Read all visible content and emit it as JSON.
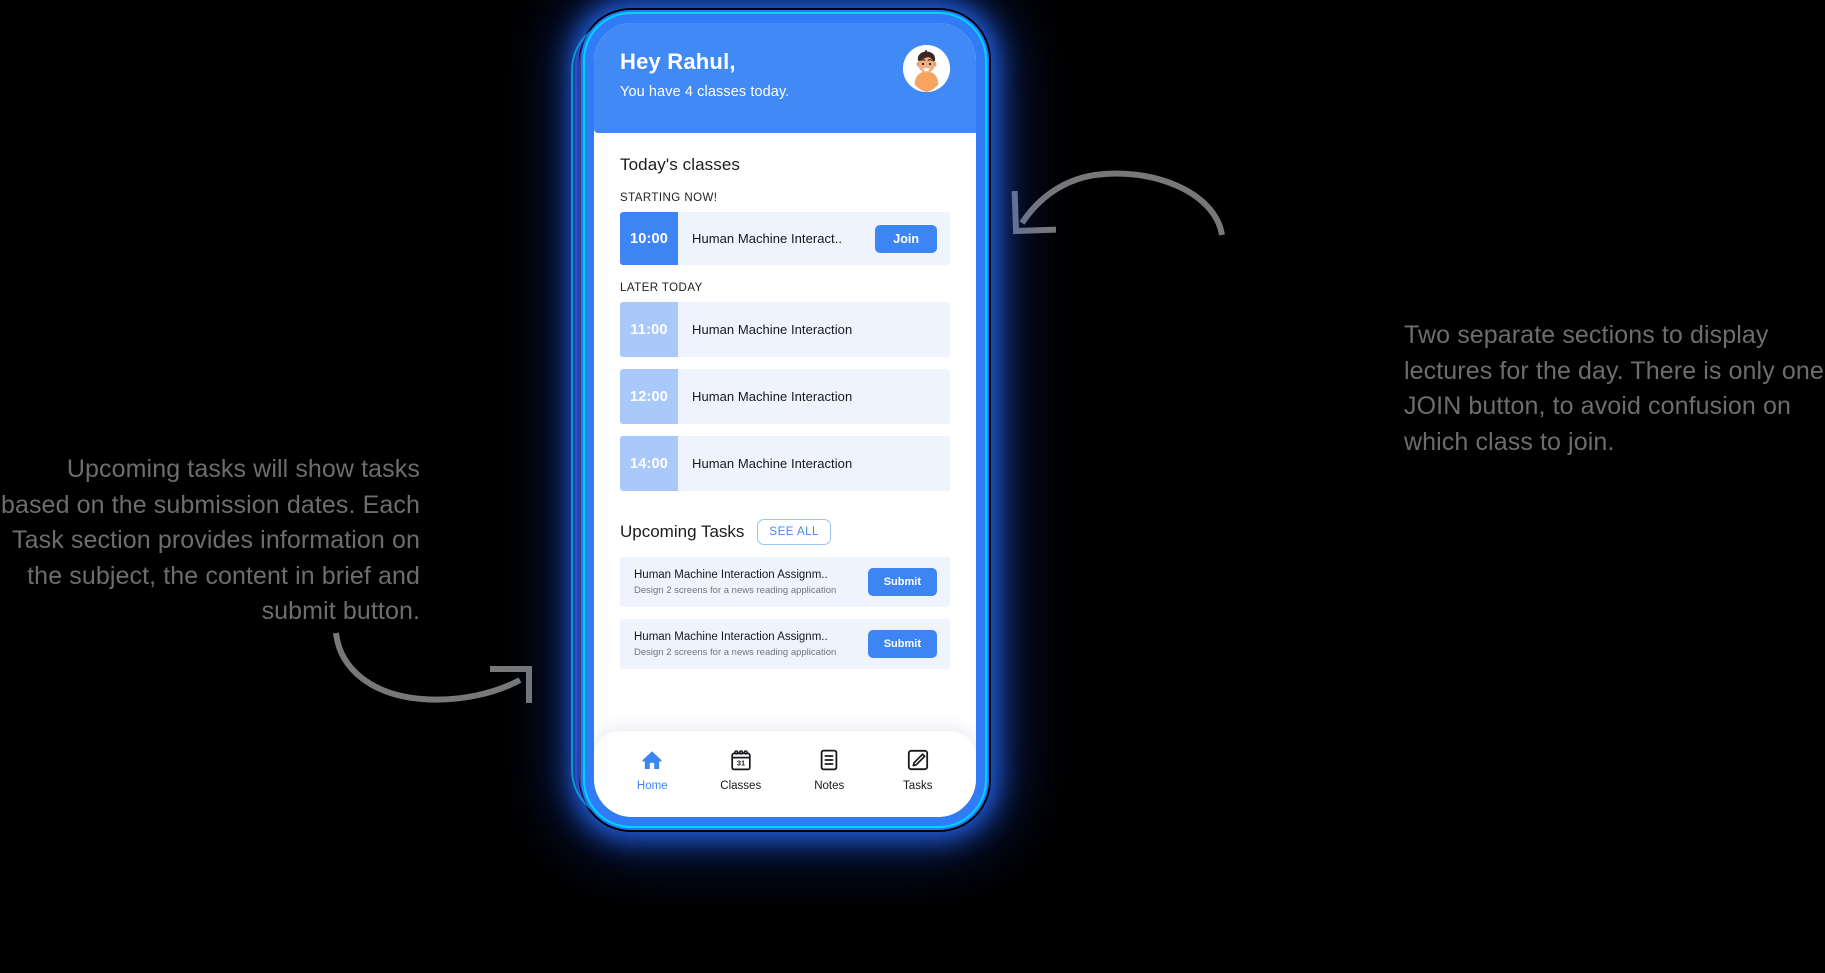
{
  "background_color": "#000000",
  "accent_color": "#3d85f3",
  "annotations": {
    "left": "Upcoming tasks will show tasks based on the submission dates. Each Task section provides information on the subject, the content in brief and submit button.",
    "right": "Two separate sections to display lectures for the day. There is only one JOIN button, to avoid confusion on which class to join."
  },
  "phone": {
    "header": {
      "greeting": "Hey Rahul,",
      "subtitle": "You have 4 classes today.",
      "avatar_icon": "user-avatar"
    },
    "classes": {
      "section_title": "Today's classes",
      "groups": [
        {
          "label": "STARTING NOW!",
          "rows": [
            {
              "time": "10:00",
              "name": "Human Machine Interact..",
              "action": "Join",
              "has_action": true
            }
          ]
        },
        {
          "label": "LATER TODAY",
          "rows": [
            {
              "time": "11:00",
              "name": "Human Machine Interaction",
              "has_action": false
            },
            {
              "time": "12:00",
              "name": "Human Machine Interaction",
              "has_action": false
            },
            {
              "time": "14:00",
              "name": "Human Machine Interaction",
              "has_action": false
            }
          ]
        }
      ]
    },
    "tasks": {
      "section_title": "Upcoming Tasks",
      "see_all_label": "SEE ALL",
      "items": [
        {
          "title": "Human Machine Interaction Assignm..",
          "description": "Design 2 screens for a news reading application",
          "action": "Submit"
        },
        {
          "title": "Human Machine Interaction Assignm..",
          "description": "Design 2 screens for a news reading application",
          "action": "Submit"
        }
      ]
    },
    "bottom_nav": [
      {
        "label": "Home",
        "icon": "home-icon",
        "active": true
      },
      {
        "label": "Classes",
        "icon": "calendar-icon",
        "active": false
      },
      {
        "label": "Notes",
        "icon": "notes-icon",
        "active": false
      },
      {
        "label": "Tasks",
        "icon": "pencil-icon",
        "active": false
      }
    ]
  }
}
